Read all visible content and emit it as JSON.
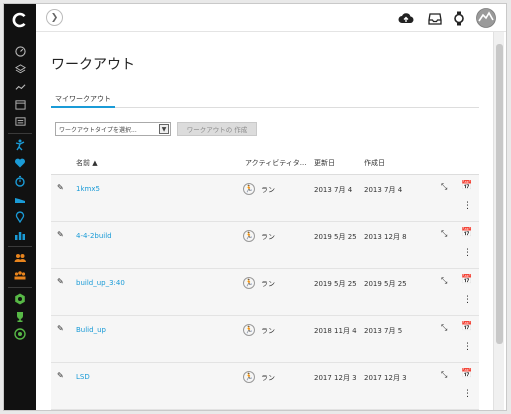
{
  "sidebar": {
    "logo": "garmin-c-logo",
    "icons": [
      "dashboard-icon",
      "layers-icon",
      "trend-icon",
      "calendar-icon",
      "news-icon",
      "activity-icon",
      "heart-icon",
      "timer-icon",
      "shoe-icon",
      "location-icon",
      "bar-chart-icon",
      "group-icon",
      "connections-icon",
      "badge-icon",
      "trophy-icon",
      "target-icon"
    ],
    "icon_colors": {
      "normal": "#bbbbbb",
      "blue": "#1a9bd7",
      "orange": "#e8841d",
      "green": "#57b846"
    },
    "calendar_day": "31"
  },
  "topbar": {
    "back_symbol": "❯",
    "icons": [
      "upload-cloud-icon",
      "inbox-icon",
      "watch-icon",
      "avatar"
    ]
  },
  "page": {
    "title": "ワークアウト",
    "tab": "マイワークアウト",
    "select_placeholder": "ワークアウトタイプを選択...",
    "create_button": "ワークアウトの 作成"
  },
  "table": {
    "headers": {
      "name": "名前 ▲",
      "activity": "アクティビティタ...",
      "updated": "更新日",
      "created": "作成日"
    },
    "rows": [
      {
        "name": "1kmx5",
        "activity": "ラン",
        "updated": "2013 7月 4",
        "created": "2013 7月 4"
      },
      {
        "name": "4-4-2build",
        "activity": "ラン",
        "updated": "2019 5月 25",
        "created": "2013 12月 8"
      },
      {
        "name": "build_up_3:40",
        "activity": "ラン",
        "updated": "2019 5月 25",
        "created": "2019 5月 25"
      },
      {
        "name": "Bulid_up",
        "activity": "ラン",
        "updated": "2018 11月 4",
        "created": "2013 7月 5"
      },
      {
        "name": "LSD",
        "activity": "ラン",
        "updated": "2017 12月 3",
        "created": "2017 12月 3"
      }
    ],
    "calendar_day": "31"
  },
  "colors": {
    "accent": "#1a9bd7",
    "sidebar_bg": "#111111"
  }
}
